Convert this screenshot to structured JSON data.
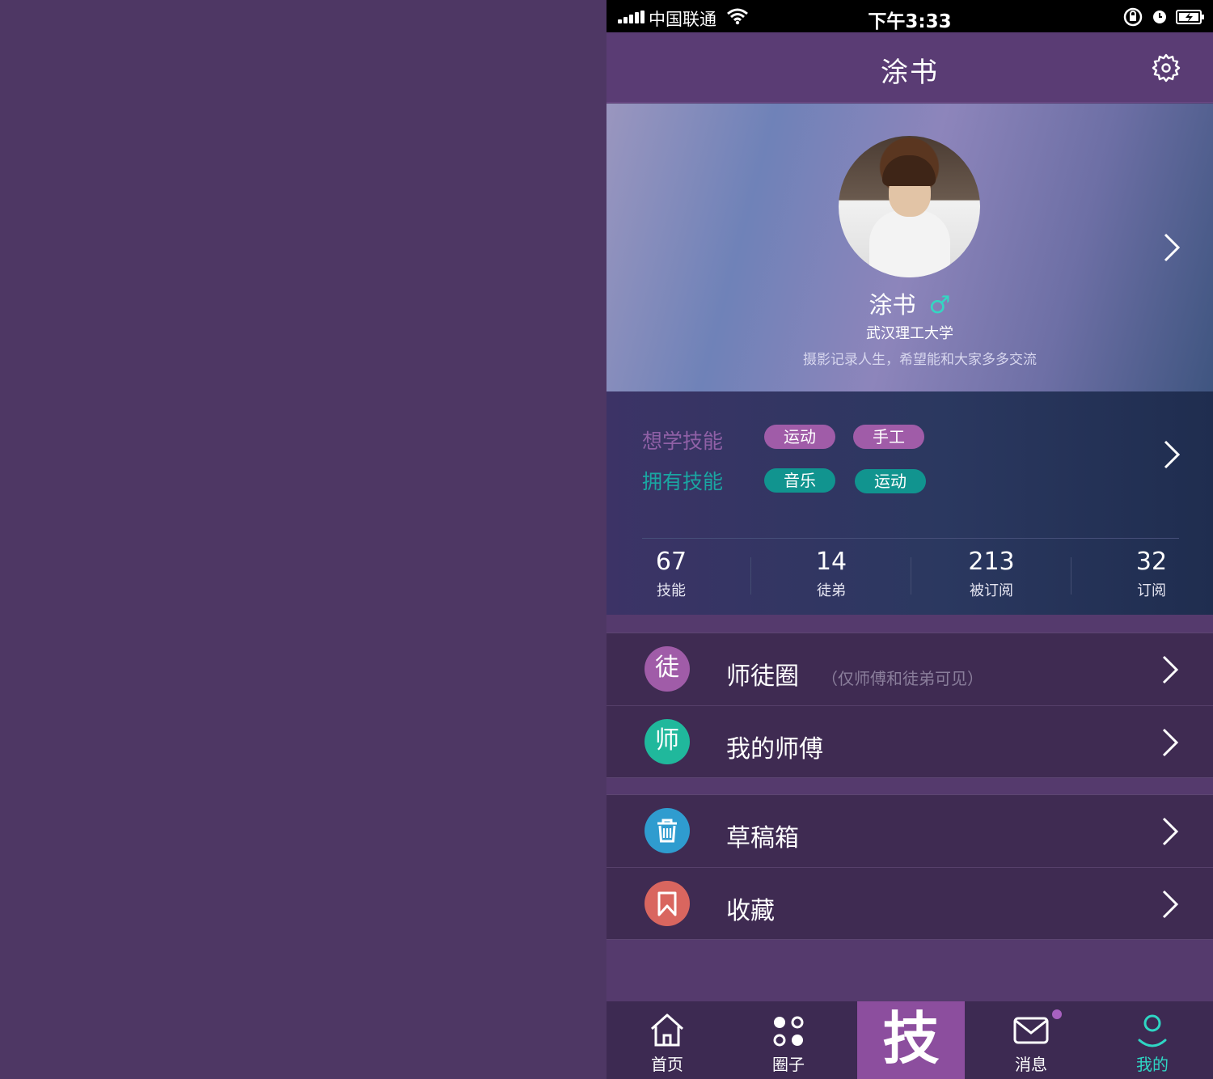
{
  "status_bar": {
    "carrier": "中国联通",
    "time": "下午3:33"
  },
  "navbar": {
    "title": "涂书",
    "settings_icon": "gear-icon"
  },
  "profile": {
    "name": "涂书",
    "gender_symbol": "♂",
    "school": "武汉理工大学",
    "bio": "摄影记录人生，希望能和大家多多交流",
    "gradient_colors": [
      "#9a96bf",
      "#6f82b8",
      "#3f5580"
    ]
  },
  "skills": {
    "want_label": "想学技能",
    "want_tags": [
      "运动",
      "手工"
    ],
    "have_label": "拥有技能",
    "have_tags": [
      "音乐",
      "运动"
    ],
    "want_color": "#a05ca8",
    "have_color": "#11948f"
  },
  "stats": [
    {
      "value": "67",
      "label": "技能"
    },
    {
      "value": "14",
      "label": "徒弟"
    },
    {
      "value": "213",
      "label": "被订阅"
    },
    {
      "value": "32",
      "label": "订阅"
    }
  ],
  "menu_group_1": [
    {
      "icon_char": "徒",
      "icon_color": "#a05ca8",
      "label": "师徒圈",
      "note": "（仅师傅和徒弟可见）"
    },
    {
      "icon_char": "师",
      "icon_color": "#20b89c",
      "label": "我的师傅"
    }
  ],
  "menu_group_2": [
    {
      "icon": "trash-icon",
      "icon_color": "#2f9ccf",
      "label": "草稿箱"
    },
    {
      "icon": "bookmark-icon",
      "icon_color": "#d9665f",
      "label": "收藏"
    }
  ],
  "tabbar": {
    "tabs": [
      {
        "label": "首页",
        "icon": "home-icon"
      },
      {
        "label": "圈子",
        "icon": "circles-icon"
      },
      {
        "label": "技",
        "icon": "skill-icon"
      },
      {
        "label": "消息",
        "icon": "mail-icon"
      },
      {
        "label": "我的",
        "icon": "user-icon"
      }
    ],
    "active_color": "#2fd6c4"
  }
}
